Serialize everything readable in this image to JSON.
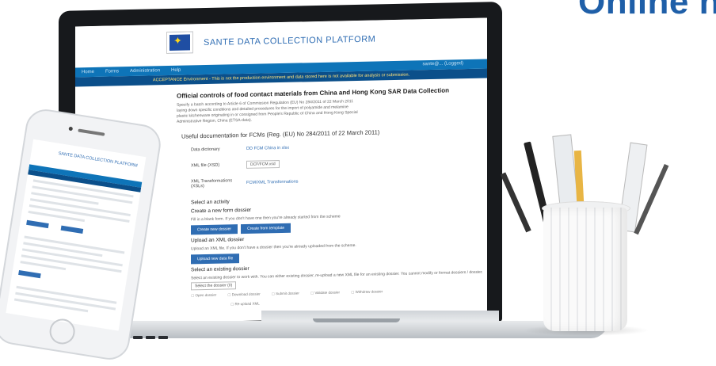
{
  "headline": "Online h",
  "screen": {
    "app_title": "SANTE DATA COLLECTION PLATFORM",
    "nav_items": [
      "Home",
      "Forms",
      "Administration",
      "Help"
    ],
    "user_label": "sante@... (Logged)",
    "banner": "ACCEPTANCE Environment - This is not the production environment and data stored here is not available for analysis or submission.",
    "heading": "Official controls of food contact materials from China and Hong Kong SAR Data Collection",
    "intro": "Specify a batch according to Article 6 of Commission Regulation (EU) No 284/2011 of 22 March 2011 laying down specific conditions and detailed procedures for the import of polyamide and melamine plastic kitchenware originating in or consigned from People's Republic of China and Hong Kong Special Administrative Region, China (ETSA-data).",
    "doc_heading": "Useful documentation for FCMs (Reg. (EU) No 284/2011 of 22 March 2011)",
    "rows": [
      {
        "label": "Data dictionary",
        "value": "DD FCM China in xlsx"
      },
      {
        "label": "XML file (XSD)",
        "value": "DCF/FCM.xsd"
      },
      {
        "label": "XML Transformations (XSLs)",
        "value": "FCM/XML Transformations"
      }
    ],
    "activity_heading": "Select an activity",
    "create_title": "Create a new form dossier",
    "create_sub": "Fill in a blank form. If you don't have one then you're already started from the scheme",
    "create_buttons": [
      "Create new dossier",
      "Create from template"
    ],
    "upload_title": "Upload an XML dossier",
    "upload_sub": "Upload an XML file. If you don't have a dossier then you're already uploaded from the scheme.",
    "upload_button": "Upload new data file",
    "existing_title": "Select an existing dossier",
    "existing_sub": "Select an existing dossier to work with. You can either existing dossier, re-upload a new XML file for an existing dossier. You cannot modify or format dossiers / dossier.",
    "select_placeholder": "Select the dossier (0)",
    "actions": [
      "Open dossier",
      "Download dossier",
      "Submit dossier",
      "Validate dossier",
      "Withdraw dossier"
    ],
    "footer_action": "Re-upload XML"
  },
  "phone": {
    "app_title": "SANTE DATA COLLECTION PLATFORM"
  }
}
